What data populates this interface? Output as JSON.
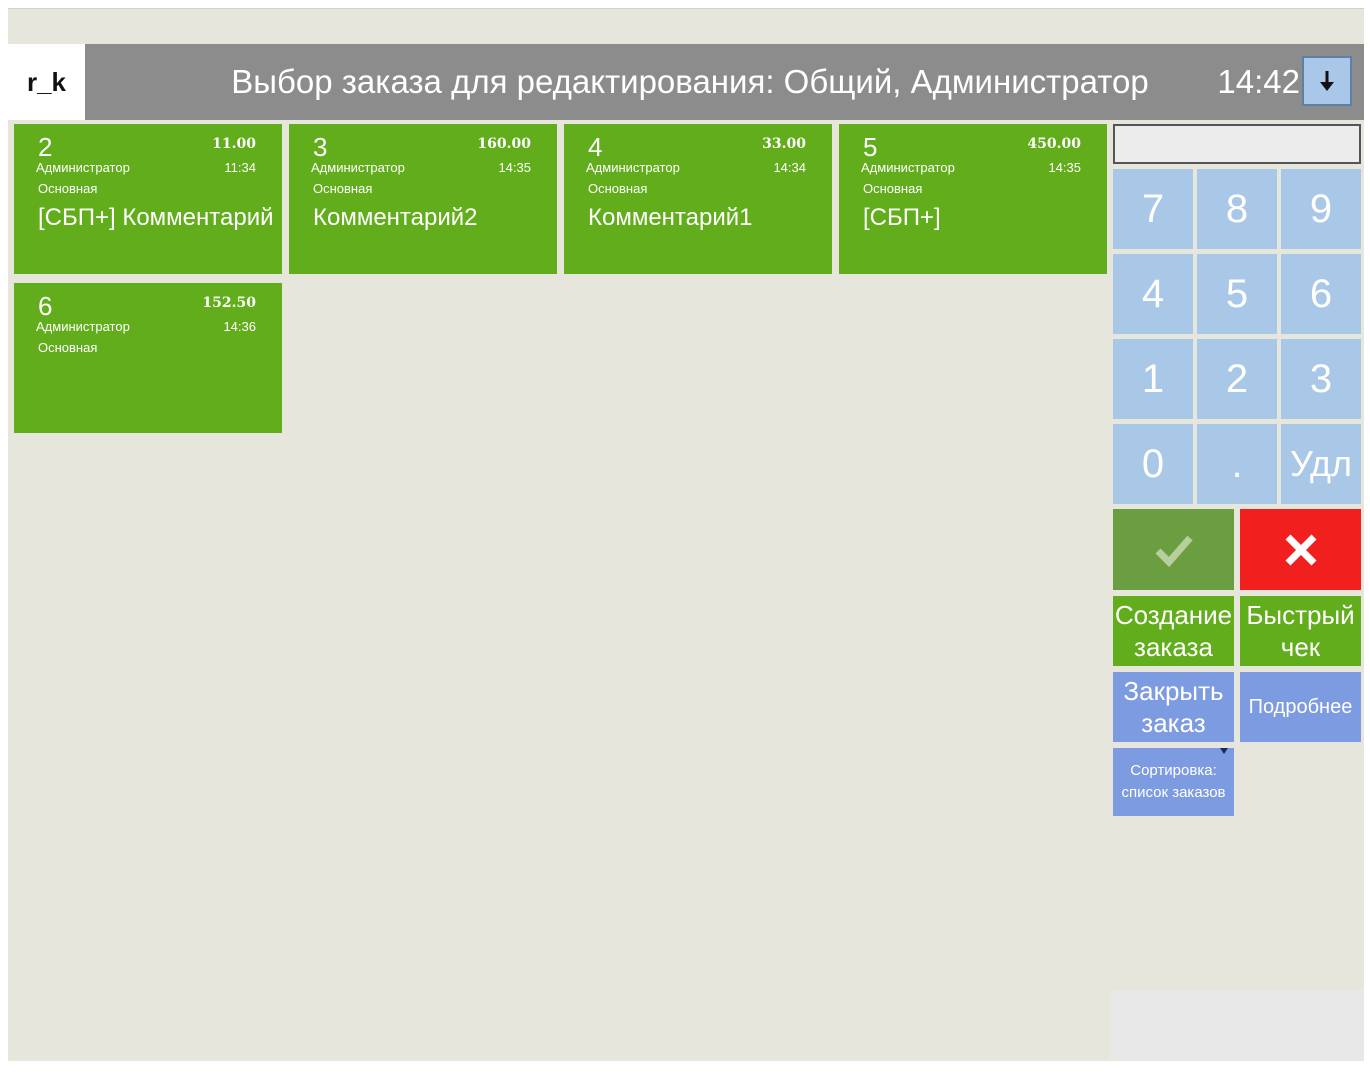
{
  "header": {
    "logo": "r_k",
    "title": "Выбор заказа для редактирования: Общий, Администратор",
    "time": "14:42",
    "down_icon": "arrow-down-icon"
  },
  "orders": [
    {
      "num": "2",
      "sum": "11.00",
      "user": "Администратор",
      "time": "11:34",
      "hall": "Основная",
      "comment": "[СБП+] Комментарий"
    },
    {
      "num": "3",
      "sum": "160.00",
      "user": "Администратор",
      "time": "14:35",
      "hall": "Основная",
      "comment": "Комментарий2"
    },
    {
      "num": "4",
      "sum": "33.00",
      "user": "Администратор",
      "time": "14:34",
      "hall": "Основная",
      "comment": "Комментарий1"
    },
    {
      "num": "5",
      "sum": "450.00",
      "user": "Администратор",
      "time": "14:35",
      "hall": "Основная",
      "comment": "[СБП+]"
    },
    {
      "num": "6",
      "sum": "152.50",
      "user": "Администратор",
      "time": "14:36",
      "hall": "Основная",
      "comment": ""
    }
  ],
  "numpad": {
    "input_value": "",
    "keys": [
      "7",
      "8",
      "9",
      "4",
      "5",
      "6",
      "1",
      "2",
      "3",
      "0",
      ".",
      "Удл"
    ]
  },
  "actions": {
    "ok_icon": "check-icon",
    "cancel_icon": "close-icon",
    "create_order": [
      "Создание",
      "заказа"
    ],
    "quick_check": [
      "Быстрый",
      "чек"
    ],
    "close_order": [
      "Закрыть",
      "заказ"
    ],
    "details": "Подробнее",
    "sort": [
      "Сортировка:",
      "список заказов"
    ]
  },
  "colors": {
    "order_card": "#62ad1c",
    "numpad_key": "#a9c7e6",
    "ok": "#6a9e40",
    "cancel": "#f21f1f",
    "blue_action": "#7d9be0",
    "header": "#8c8c8c",
    "background": "#e6e6dc"
  }
}
